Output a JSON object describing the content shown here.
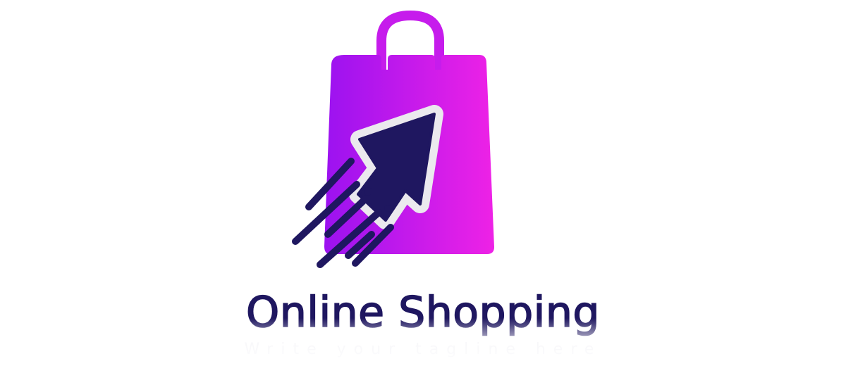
{
  "brand": {
    "name": "Online Shopping",
    "tagline": "Write your tagline here"
  },
  "logo": {
    "icon": "shopping-bag-with-cursor-arrow",
    "colors": {
      "bag_gradient_start": "#9b12f0",
      "bag_gradient_end": "#ee22e6",
      "arrow_fill": "#1f1760",
      "arrow_outline": "#ebe9ee",
      "text": "#1f1760"
    }
  }
}
